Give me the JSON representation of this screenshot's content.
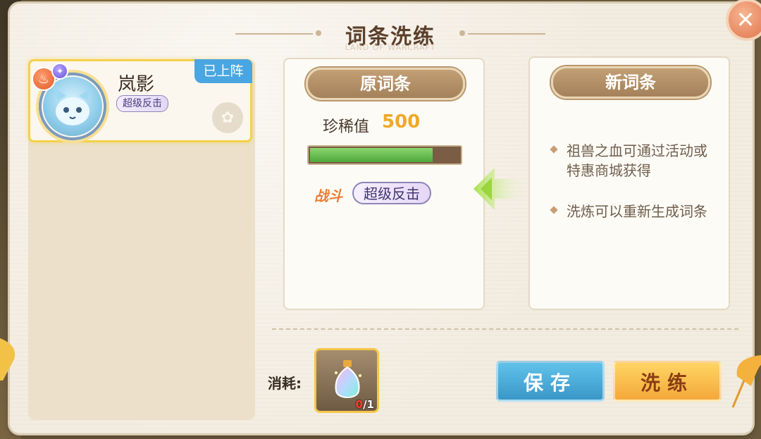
{
  "dialog": {
    "title": "词条洗练",
    "subtitle": "LAND OF WARCRAFT",
    "close_icon": "close-icon"
  },
  "pet_card": {
    "name": "岚影",
    "trait": "超级反击",
    "status_badge": "已上阵",
    "element_icon": "fire-icon",
    "rank_icon": "star-icon"
  },
  "original_trait": {
    "header": "原词条",
    "rarity_label": "珍稀值",
    "rarity_value": "500",
    "progress": 0.82,
    "category_label": "战斗",
    "trait_name": "超级反击"
  },
  "new_trait": {
    "header": "新词条",
    "tips": [
      "祖兽之血可通过活动或特惠商城获得",
      "洗炼可以重新生成词条"
    ]
  },
  "cost": {
    "label": "消耗:",
    "item_icon": "potion-icon",
    "owned": "0",
    "needed": "/1"
  },
  "buttons": {
    "save": "保存",
    "refine": "洗练"
  },
  "colors": {
    "accent_gold": "#f5d14c",
    "save_blue": "#4aa6e0",
    "refine_orange": "#f3a83a",
    "rarity_orange": "#f0a928"
  }
}
